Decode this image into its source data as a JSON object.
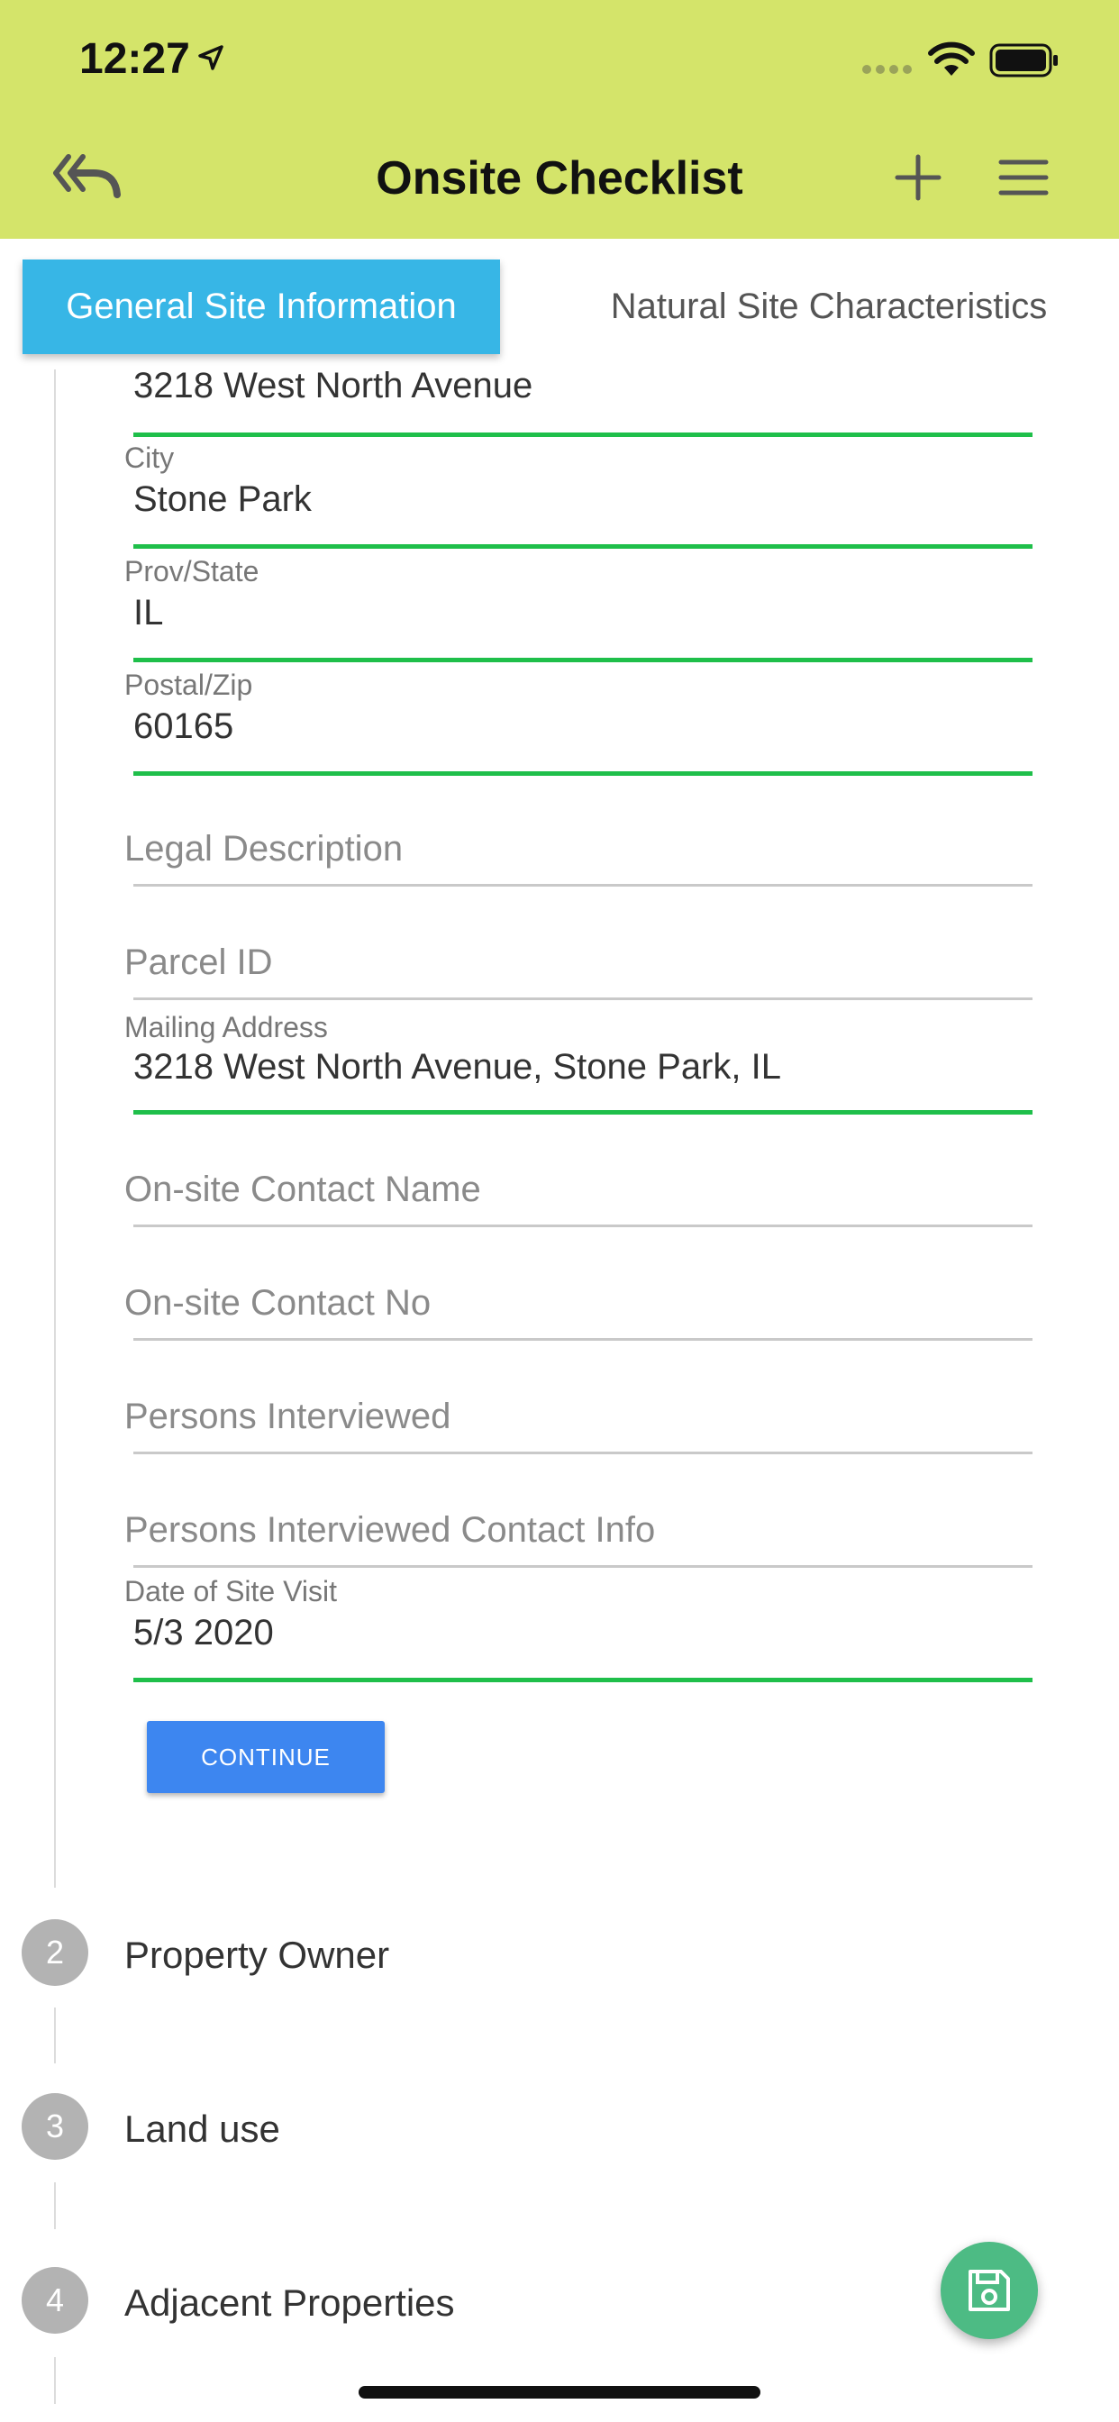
{
  "status_bar": {
    "time": "12:27"
  },
  "header": {
    "title": "Onsite Checklist"
  },
  "tabs": [
    {
      "label": "General Site Information",
      "active": true
    },
    {
      "label": "Natural Site Characteristics",
      "active": false
    }
  ],
  "form": {
    "address_value": "3218 West North Avenue",
    "city": {
      "label": "City",
      "value": "Stone Park"
    },
    "state": {
      "label": "Prov/State",
      "value": "IL"
    },
    "zip": {
      "label": "Postal/Zip",
      "value": "60165"
    },
    "legal_description": {
      "placeholder": "Legal Description"
    },
    "parcel_id": {
      "placeholder": "Parcel ID"
    },
    "mailing_address": {
      "label": "Mailing Address",
      "value": "3218 West North Avenue, Stone Park, IL"
    },
    "contact_name": {
      "placeholder": "On-site Contact Name"
    },
    "contact_no": {
      "placeholder": "On-site Contact No"
    },
    "persons_interviewed": {
      "placeholder": "Persons Interviewed"
    },
    "persons_contact_info": {
      "placeholder": "Persons Interviewed Contact Info"
    },
    "date_of_visit": {
      "label": "Date of Site Visit",
      "value": "5/3 2020"
    },
    "continue_label": "CONTINUE"
  },
  "steps": [
    {
      "number": "2",
      "label": "Property Owner"
    },
    {
      "number": "3",
      "label": "Land use"
    },
    {
      "number": "4",
      "label": "Adjacent Properties"
    }
  ],
  "colors": {
    "header_bg": "#d4e46a",
    "tab_active": "#37b6e6",
    "field_underline_filled": "#1fbf4a",
    "continue_button": "#3d86f0",
    "save_fab": "#4dbb84"
  }
}
